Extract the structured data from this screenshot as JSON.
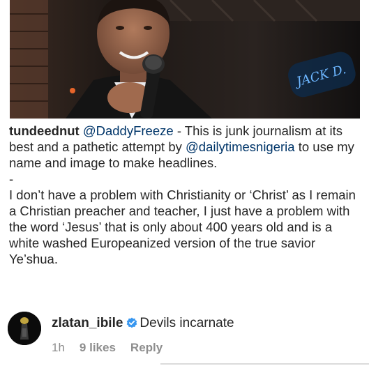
{
  "post": {
    "username": "tundeednut",
    "mention_1": "@DaddyFreeze",
    "text_1": " - This is junk journalism at its best and a pathetic attempt by ",
    "mention_2": "@dailytimesnigeria",
    "text_2": " to use my name and image to make headlines.",
    "dash": "-",
    "paragraph_2": "I don’t have a problem with Christianity or ‘Christ’ as I remain a Christian preacher and teacher, I just have a problem with the word ‘Jesus’ that is only about 400 years old and is a white washed Europeanized version of the true savior Ye’shua."
  },
  "comment": {
    "username": "zlatan_ibile",
    "text": "Devils incarnate",
    "time": "1h",
    "likes": "9 likes",
    "reply_label": "Reply"
  },
  "colors": {
    "text": "#262626",
    "mention": "#003569",
    "meta": "#8e8e8e",
    "verified": "#3897f0"
  },
  "icons": {
    "verified_badge": "verified-badge-icon"
  }
}
